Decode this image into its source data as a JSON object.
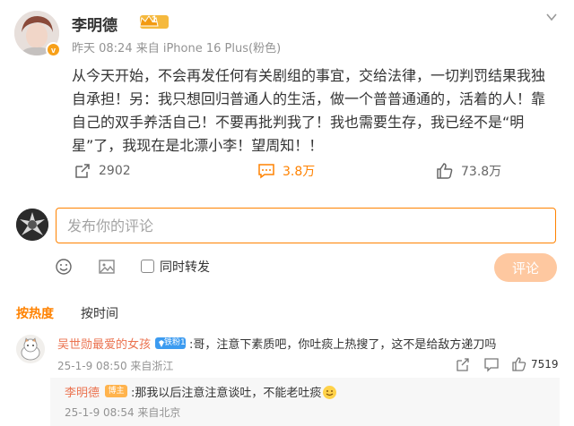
{
  "post": {
    "username": "李明德",
    "level": "1",
    "verify_mark": "v",
    "meta": "昨天 08:24 来自 iPhone 16 Plus(粉色)",
    "text": "从今天开始，不会再发任何有关剧组的事宜，交给法律，一切判罚结果我独自承担！另：我只想回归普通人的生活，做一个普普通通的，活着的人！靠自己的双手养活自己！不要再批判我了！我也需要生存，我已经不是“明星”了，我现在是北漂小李！望周知！！",
    "repost_count": "2902",
    "comment_count": "3.8万",
    "like_count": "73.8万"
  },
  "comment_box": {
    "placeholder": "发布你的评论",
    "repost_label": "同时转发",
    "submit_label": "评论"
  },
  "sort": {
    "hot_label": "按热度",
    "time_label": "按时间"
  },
  "comments": [
    {
      "user": "吴世勋最爱的女孩",
      "badge": "铁粉1",
      "text": ":哥，注意下素质吧，你吐痰上热搜了，这不是给敌方递刀吗",
      "meta": "25-1-9 08:50 来自浙江",
      "likes": "7519",
      "reply": {
        "user": "李明德",
        "badge": "博主",
        "text": ":那我以后注意注意谈吐，不能老吐痰",
        "meta": "25-1-9 08:54 来自北京"
      }
    }
  ],
  "colors": {
    "accent": "#ff8200",
    "username_link": "#eb7350",
    "meta_gray": "#939393"
  },
  "icons": [
    "more-icon",
    "repost-icon",
    "comment-icon",
    "like-icon",
    "emoji-icon",
    "image-icon",
    "share-icon"
  ]
}
